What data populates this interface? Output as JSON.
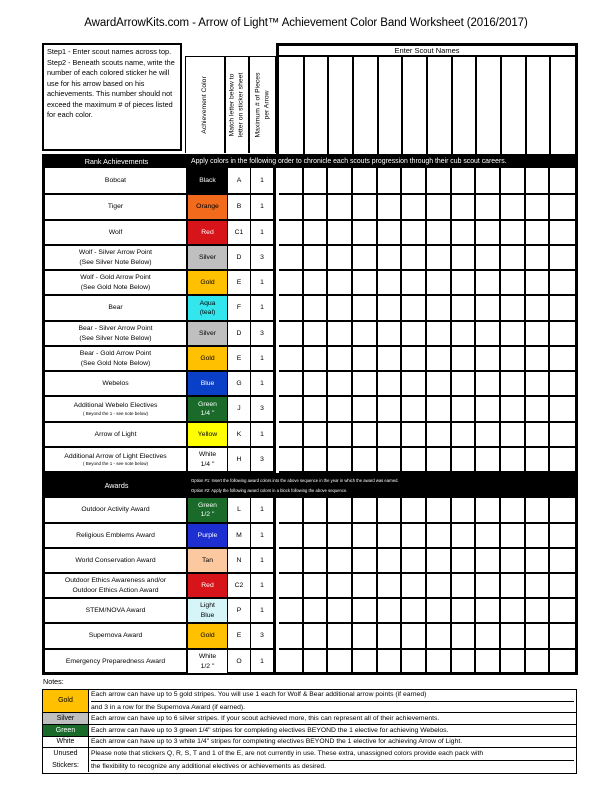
{
  "title": "AwardArrowKits.com - Arrow of Light™ Achievement Color Band Worksheet (2016/2017)",
  "instructions": {
    "step1": "Step1 - Enter scout names across top.",
    "step2": "Step2 - Beneath scouts name, write the number of each colored sticker he will use for his arrow based on his achievements. This number should not exceed the maximum # of pieces listed for each color."
  },
  "column_headers": {
    "color": "Achievement Color",
    "letter": "Match letter below to letter on sticker sheet",
    "letter_line1": "Match letter below to",
    "letter_line2": "letter on sticker sheet",
    "max_line1": "Maximum # of Pieces",
    "max_line2": "per Arrow",
    "scout_names": "Enter Scout Names"
  },
  "scout_count": 12,
  "rank_section": {
    "label": "Rank Achievements",
    "instruction": "Apply colors in the following order to chronicle each scouts progression through their cub scout careers.",
    "rows": [
      {
        "name": "Bobcat",
        "sub": "",
        "color": "Black",
        "color_hex": "#000000",
        "text_hex": "#ffffff",
        "letter": "A",
        "max": "1"
      },
      {
        "name": "Tiger",
        "sub": "",
        "color": "Orange",
        "color_hex": "#f26b1d",
        "text_hex": "#000000",
        "letter": "B",
        "max": "1"
      },
      {
        "name": "Wolf",
        "sub": "",
        "color": "Red",
        "color_hex": "#d7141a",
        "text_hex": "#ffffff",
        "letter": "C1",
        "max": "1"
      },
      {
        "name": "Wolf - Silver Arrow Point",
        "sub2": "(See Silver Note Below)",
        "sub": "",
        "color": "Silver",
        "color_hex": "#bfbfbf",
        "text_hex": "#000000",
        "letter": "D",
        "max": "3"
      },
      {
        "name": "Wolf - Gold Arrow Point",
        "sub2": "(See Gold Note Below)",
        "sub": "",
        "color": "Gold",
        "color_hex": "#ffc000",
        "text_hex": "#000000",
        "letter": "E",
        "max": "1"
      },
      {
        "name": "Bear",
        "sub": "",
        "color": "Aqua",
        "color2": "(teal)",
        "color_hex": "#33e6ee",
        "text_hex": "#000000",
        "letter": "F",
        "max": "1"
      },
      {
        "name": "Bear - Silver Arrow Point",
        "sub2": "(See Silver Note Below)",
        "sub": "",
        "color": "Silver",
        "color_hex": "#bfbfbf",
        "text_hex": "#000000",
        "letter": "D",
        "max": "3"
      },
      {
        "name": "Bear - Gold Arrow Point",
        "sub2": "(See Gold Note Below)",
        "sub": "",
        "color": "Gold",
        "color_hex": "#ffc000",
        "text_hex": "#000000",
        "letter": "E",
        "max": "1"
      },
      {
        "name": "Webelos",
        "sub": "",
        "color": "Blue",
        "color_hex": "#0a3fc8",
        "text_hex": "#ffffff",
        "letter": "G",
        "max": "1"
      },
      {
        "name": "Additional Webelo Electives",
        "sub": "( Beyond the 1 - see note below)",
        "color": "Green",
        "color2": "1/4 \"",
        "color_hex": "#1a6b2a",
        "text_hex": "#ffffff",
        "letter": "J",
        "max": "3"
      },
      {
        "name": "Arrow of Light",
        "sub": "",
        "color": "Yellow",
        "color_hex": "#ffff00",
        "text_hex": "#000000",
        "letter": "K",
        "max": "1"
      },
      {
        "name": "Additional Arrow of Light Electives",
        "sub": "( Beyond the 1 - see note below)",
        "color": "White",
        "color2": "1/4 \"",
        "color_hex": "#ffffff",
        "text_hex": "#000000",
        "letter": "H",
        "max": "3"
      }
    ]
  },
  "awards_section": {
    "label": "Awards",
    "option1": "Option #1: Insert the following award colors into the above sequence in the year in which the award was earned.",
    "option2": "Option #2: Apply the following award colors in a block following the above sequence.",
    "rows": [
      {
        "name": "Outdoor Activity Award",
        "sub": "",
        "color": "Green",
        "color2": "1/2 \"",
        "color_hex": "#1a6b2a",
        "text_hex": "#ffffff",
        "letter": "L",
        "max": "1"
      },
      {
        "name": "Religious Emblems Award",
        "sub": "",
        "color": "Purple",
        "color_hex": "#1d2fd0",
        "text_hex": "#ffffff",
        "letter": "M",
        "max": "1"
      },
      {
        "name": "World Conservation Award",
        "sub": "",
        "color": "Tan",
        "color_hex": "#fbc8a0",
        "text_hex": "#000000",
        "letter": "N",
        "max": "1"
      },
      {
        "name": "Outdoor Ethics Awareness and/or",
        "sub2": "Outdoor Ethics Action Award",
        "sub": "",
        "color": "Red",
        "color_hex": "#d7141a",
        "text_hex": "#ffffff",
        "letter": "C2",
        "max": "1"
      },
      {
        "name": "STEM/NOVA Award",
        "sub": "",
        "color": "Light",
        "color2": "Blue",
        "color_hex": "#d6f5f8",
        "text_hex": "#000000",
        "letter": "P",
        "max": "1"
      },
      {
        "name": "Supernova Award",
        "sub": "",
        "color": "Gold",
        "color_hex": "#ffc000",
        "text_hex": "#000000",
        "letter": "E",
        "max": "3"
      },
      {
        "name": "Emergency Preparedness Award",
        "sub": "",
        "color": "White",
        "color2": "1/2 \"",
        "color_hex": "#ffffff",
        "text_hex": "#000000",
        "letter": "O",
        "max": "1"
      }
    ]
  },
  "notes": {
    "label": "Notes:",
    "items": [
      {
        "label": "Gold",
        "bg": "#ffc000",
        "fg": "#000000",
        "lines": [
          "Each arrow can have up to 5 gold stripes.  You will use 1 each for Wolf & Bear additional arrow points (if earned)",
          "and 3 in a row for the Supernova Award (if earned)."
        ]
      },
      {
        "label": "Silver",
        "bg": "#bfbfbf",
        "fg": "#000000",
        "lines": [
          "Each arrow can have up to 6 silver stripes. If your scout achieved more, this can represent all of their achievements."
        ]
      },
      {
        "label": "Green",
        "bg": "#1a6b2a",
        "fg": "#ffffff",
        "lines": [
          "Each arrow can have up to 3 green 1/4\" stripes for completing electives BEYOND the 1 elective for achieving Webelos."
        ]
      },
      {
        "label": "White",
        "bg": "#ffffff",
        "fg": "#000000",
        "lines": [
          "Each arrow can have up to 3 white 1/4\" stripes for completing electives BEYOND the 1 elective for achieving Arrow of Light."
        ]
      },
      {
        "label": "Unused Stickers:",
        "label1": "Unused",
        "label2": "Stickers:",
        "bg": "#ffffff",
        "fg": "#000000",
        "lines": [
          "Please note that stickers Q, R, S, T and 1 of the E, are not currently in use.  These extra, unassigned colors provide each pack with",
          "the flexibility to recognize any additional electives or achievements as desired."
        ]
      }
    ]
  }
}
